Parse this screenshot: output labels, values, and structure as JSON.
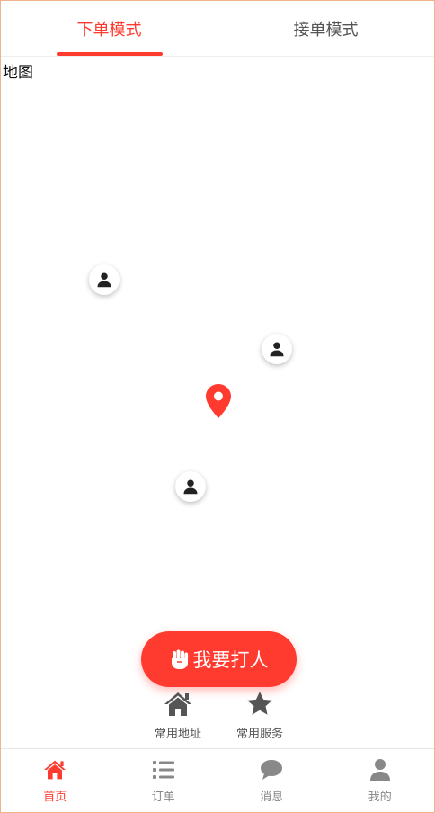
{
  "tabs": [
    {
      "label": "下单模式",
      "active": true
    },
    {
      "label": "接单模式",
      "active": false
    }
  ],
  "map": {
    "label": "地图",
    "markers": [
      {
        "type": "person-icon"
      },
      {
        "type": "person-icon"
      },
      {
        "type": "person-icon"
      },
      {
        "type": "location-pin-icon"
      }
    ]
  },
  "fab": {
    "label": "我要打人",
    "icon": "fist-icon",
    "color": "#ff3b30"
  },
  "quick_actions": [
    {
      "label": "常用地址",
      "icon": "home-icon"
    },
    {
      "label": "常用服务",
      "icon": "star-icon"
    }
  ],
  "bottom_nav": [
    {
      "label": "首页",
      "icon": "home-icon",
      "active": true
    },
    {
      "label": "订单",
      "icon": "list-icon",
      "active": false
    },
    {
      "label": "消息",
      "icon": "chat-bubble-icon",
      "active": false
    },
    {
      "label": "我的",
      "icon": "user-icon",
      "active": false
    }
  ],
  "colors": {
    "accent": "#ff3b30",
    "inactive": "#888888",
    "icon_dark": "#555555"
  }
}
